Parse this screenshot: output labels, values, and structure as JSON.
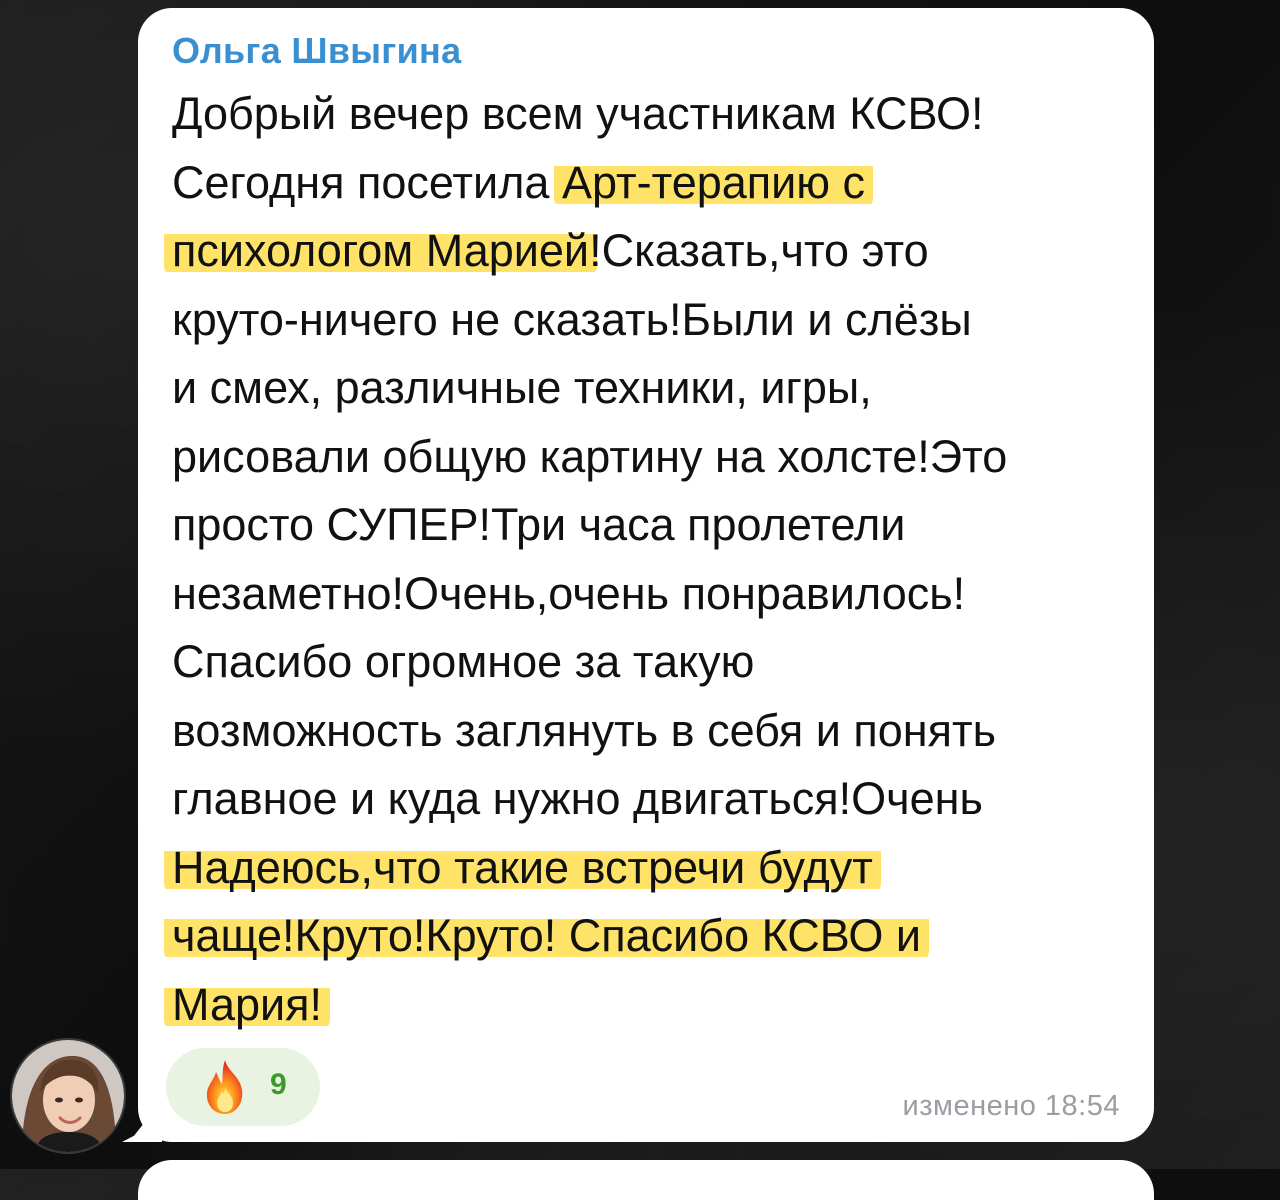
{
  "message": {
    "sender": "Ольга Швыгина",
    "lines": [
      {
        "segments": [
          {
            "text": "Добрый вечер всем участникам КСВО!",
            "highlight": false
          }
        ]
      },
      {
        "segments": [
          {
            "text": "Сегодня посетила ",
            "highlight": false
          },
          {
            "text": "Арт-терапию с",
            "highlight": true
          }
        ]
      },
      {
        "segments": [
          {
            "text": "психологом Марией",
            "highlight": true
          },
          {
            "text": "!Сказать,что это",
            "highlight": false
          }
        ]
      },
      {
        "segments": [
          {
            "text": "круто-ничего не сказать!Были и  слёзы",
            "highlight": false
          }
        ]
      },
      {
        "segments": [
          {
            "text": "и смех, различные техники, игры,",
            "highlight": false
          }
        ]
      },
      {
        "segments": [
          {
            "text": "рисовали общую картину на холсте!Это",
            "highlight": false
          }
        ]
      },
      {
        "segments": [
          {
            "text": "просто СУПЕР!Три часа пролетели",
            "highlight": false
          }
        ]
      },
      {
        "segments": [
          {
            "text": "незаметно!Очень,очень понравилось!",
            "highlight": false
          }
        ]
      },
      {
        "segments": [
          {
            "text": "Спасибо огромное за такую",
            "highlight": false
          }
        ]
      },
      {
        "segments": [
          {
            "text": "возможность заглянуть в себя и понять",
            "highlight": false
          }
        ]
      },
      {
        "segments": [
          {
            "text": "главное и куда нужно двигаться!Очень",
            "highlight": false
          }
        ]
      },
      {
        "segments": [
          {
            "text": "Надеюсь,что такие встречи будут",
            "highlight": true
          }
        ]
      },
      {
        "segments": [
          {
            "text": "чаще!Круто!Круто! Спасибо КСВО и",
            "highlight": true
          }
        ]
      },
      {
        "segments": [
          {
            "text": "Мария!",
            "highlight": true
          }
        ]
      }
    ],
    "reaction": {
      "icon": "fire-icon",
      "count": "9"
    },
    "status": "изменено 18:54"
  },
  "colors": {
    "sender": "#3a8fd0",
    "highlight": "#ffdd4d",
    "reaction_bg": "#e9f3e2",
    "reaction_count": "#3c9a2a",
    "meta": "#9a9ea3"
  }
}
